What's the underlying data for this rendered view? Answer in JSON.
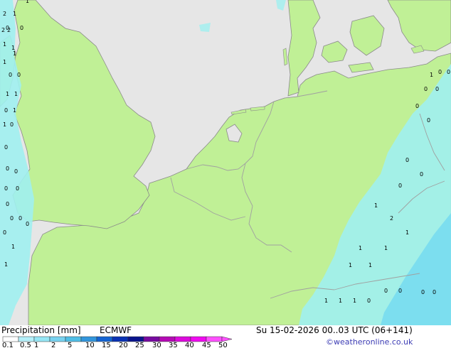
{
  "colors": {
    "sea": "#e6e6e6",
    "land": "#c0f096",
    "border": "#a0a0a0",
    "coast": "#8a8a8a",
    "precip_light": "#a0f0f0",
    "precip_mid": "#78dcf0"
  },
  "footer": {
    "title": "Precipitation [mm]",
    "model": "ECMWF",
    "datetime": "Su 15-02-2026 00..03 UTC (06+141)",
    "credit": "©weatheronline.co.uk"
  },
  "legend": {
    "ticks": [
      "0.1",
      "0.5",
      "1",
      "2",
      "5",
      "10",
      "15",
      "20",
      "25",
      "30",
      "35",
      "40",
      "45",
      "50"
    ],
    "colors": [
      "#ffffff",
      "#b4f0fa",
      "#96e6f5",
      "#78d2f0",
      "#50bee6",
      "#3296dc",
      "#1464d2",
      "#0a32b4",
      "#0a148c",
      "#780aa0",
      "#b40ab4",
      "#dc0adc",
      "#f00af0",
      "#ff50ff"
    ]
  },
  "annotations": [
    "2",
    "1",
    "1",
    "0",
    "0",
    "2",
    "2",
    "1",
    "1",
    "1",
    "1",
    "0",
    "0",
    "1",
    "1",
    "0",
    "1",
    "1",
    "0",
    "0",
    "0",
    "0",
    "0",
    "0",
    "0",
    "0",
    "0",
    "0",
    "0",
    "1",
    "1",
    "1",
    "0",
    "0",
    "0",
    "0",
    "0",
    "0",
    "0",
    "0",
    "0",
    "1",
    "2",
    "1",
    "1",
    "1",
    "1",
    "1",
    "1",
    "1",
    "1",
    "0",
    "0",
    "0",
    "0",
    "0"
  ]
}
